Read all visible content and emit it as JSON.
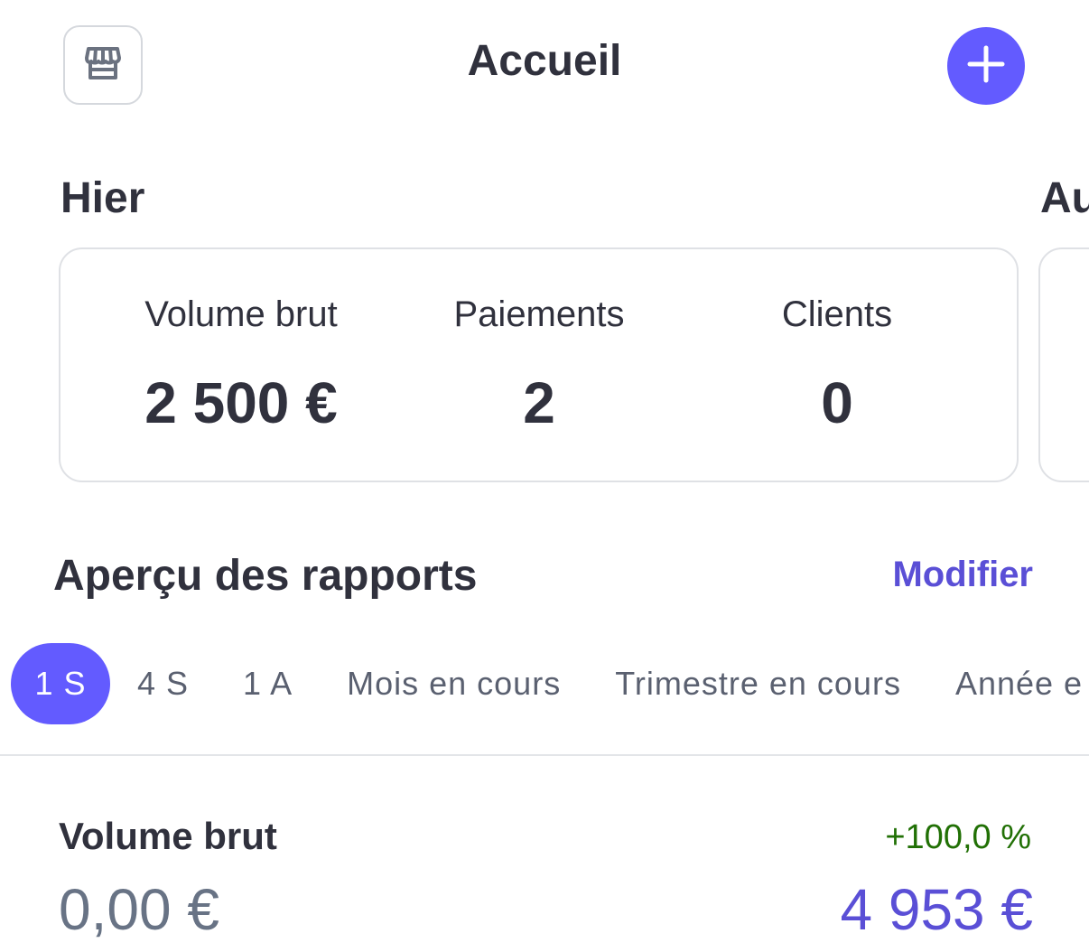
{
  "header": {
    "title": "Accueil",
    "store_icon": "storefront-icon",
    "add_icon": "plus-icon"
  },
  "yesterday": {
    "heading": "Hier",
    "stats": [
      {
        "label": "Volume brut",
        "value": "2 500 €"
      },
      {
        "label": "Paiements",
        "value": "2"
      },
      {
        "label": "Clients",
        "value": "0"
      }
    ]
  },
  "next_section": {
    "heading": "Au"
  },
  "reports": {
    "heading": "Aperçu des rapports",
    "modify_label": "Modifier",
    "tabs": [
      {
        "label": "1 S",
        "active": true
      },
      {
        "label": "4 S",
        "active": false
      },
      {
        "label": "1 A",
        "active": false
      },
      {
        "label": "Mois en cours",
        "active": false
      },
      {
        "label": "Trimestre en cours",
        "active": false
      },
      {
        "label": "Année e",
        "active": false
      }
    ],
    "metric": {
      "title": "Volume brut",
      "change": "+100,0 %",
      "previous_value": "0,00 €",
      "current_value": "4 953 €"
    }
  },
  "colors": {
    "accent": "#635bff",
    "link": "#5a4fd6",
    "positive": "#217005",
    "text": "#30313d"
  }
}
